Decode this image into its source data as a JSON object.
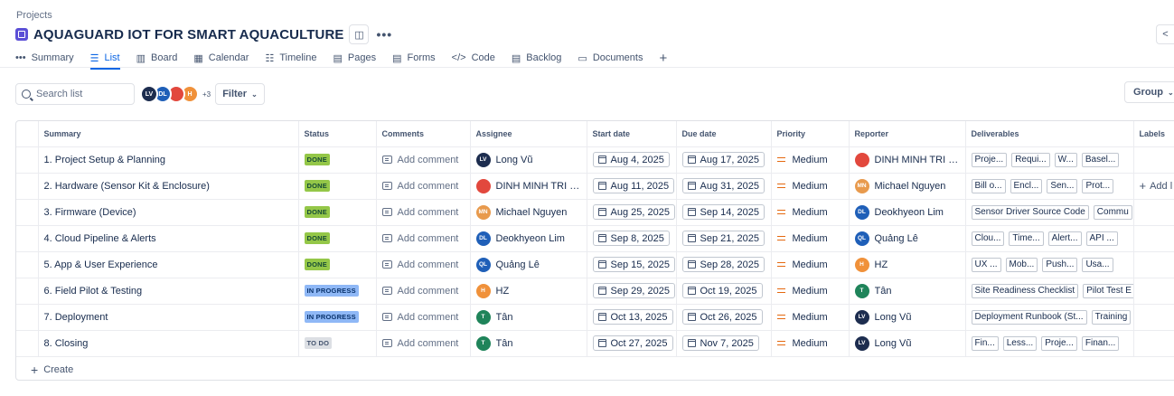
{
  "breadcrumb": "Projects",
  "project": {
    "title": "AQUAGUARD IOT FOR SMART AQUACULTURE",
    "more": "•••"
  },
  "tabs": [
    {
      "label": "Summary",
      "icon": "•••"
    },
    {
      "label": "List",
      "icon": "☰"
    },
    {
      "label": "Board",
      "icon": "▥"
    },
    {
      "label": "Calendar",
      "icon": "▦"
    },
    {
      "label": "Timeline",
      "icon": "☷"
    },
    {
      "label": "Pages",
      "icon": "▤"
    },
    {
      "label": "Forms",
      "icon": "▤"
    },
    {
      "label": "Code",
      "icon": "</>"
    },
    {
      "label": "Backlog",
      "icon": "▤"
    },
    {
      "label": "Documents",
      "icon": "▭"
    }
  ],
  "active_tab": "List",
  "toolbar": {
    "search_placeholder": "Search list",
    "avatars": [
      {
        "initials": "LV",
        "color": "#1d2d4f"
      },
      {
        "initials": "DL",
        "color": "#1f5fb8"
      },
      {
        "initials": "",
        "color": "#e2483d"
      },
      {
        "initials": "H",
        "color": "#f0913a"
      }
    ],
    "more_count": "+3",
    "filter_label": "Filter",
    "group_label": "Group"
  },
  "columns": [
    "Summary",
    "Status",
    "Comments",
    "Assignee",
    "Start date",
    "Due date",
    "Priority",
    "Reporter",
    "Deliverables",
    "Labels"
  ],
  "rows": [
    {
      "summary": "1. Project Setup & Planning",
      "status": "DONE",
      "status_kind": "done",
      "comment": "Add comment",
      "assignee": {
        "initials": "LV",
        "name": "Long Vũ",
        "color": "#1d2d4f"
      },
      "start": "Aug 4, 2025",
      "due": "Aug 17, 2025",
      "priority": "Medium",
      "reporter": {
        "initials": "",
        "name": "DINH MINH TRI VO ...",
        "color": "#e2483d"
      },
      "deliverables": [
        "Proje...",
        "Requi...",
        "W...",
        "Basel..."
      ],
      "labels": ""
    },
    {
      "summary": "2. Hardware (Sensor Kit & Enclosure)",
      "status": "DONE",
      "status_kind": "done",
      "comment": "Add comment",
      "assignee": {
        "initials": "",
        "name": "DINH MINH TRI VO ...",
        "color": "#e2483d"
      },
      "start": "Aug 11, 2025",
      "due": "Aug 31, 2025",
      "priority": "Medium",
      "reporter": {
        "initials": "MN",
        "name": "Michael Nguyen",
        "color": "#e89a4d"
      },
      "deliverables": [
        "Bill o...",
        "Encl...",
        "Sen...",
        "Prot..."
      ],
      "labels": "Add l"
    },
    {
      "summary": "3. Firmware (Device)",
      "status": "DONE",
      "status_kind": "done",
      "comment": "Add comment",
      "assignee": {
        "initials": "MN",
        "name": "Michael Nguyen",
        "color": "#e89a4d"
      },
      "start": "Aug 25, 2025",
      "due": "Sep 14, 2025",
      "priority": "Medium",
      "reporter": {
        "initials": "DL",
        "name": "Deokhyeon Lim",
        "color": "#1f5fb8"
      },
      "deliverables": [
        "Sensor Driver Source Code",
        "Commu"
      ],
      "labels": ""
    },
    {
      "summary": "4. Cloud Pipeline & Alerts",
      "status": "DONE",
      "status_kind": "done",
      "comment": "Add comment",
      "assignee": {
        "initials": "DL",
        "name": "Deokhyeon Lim",
        "color": "#1f5fb8"
      },
      "start": "Sep 8, 2025",
      "due": "Sep 21, 2025",
      "priority": "Medium",
      "reporter": {
        "initials": "QL",
        "name": "Quảng Lê",
        "color": "#1f5fb8"
      },
      "deliverables": [
        "Clou...",
        "Time...",
        "Alert...",
        "API ..."
      ],
      "labels": ""
    },
    {
      "summary": "5. App & User Experience",
      "status": "DONE",
      "status_kind": "done",
      "comment": "Add comment",
      "assignee": {
        "initials": "QL",
        "name": "Quảng Lê",
        "color": "#1f5fb8"
      },
      "start": "Sep 15, 2025",
      "due": "Sep 28, 2025",
      "priority": "Medium",
      "reporter": {
        "initials": "H",
        "name": "HZ",
        "color": "#f0913a"
      },
      "deliverables": [
        "UX ...",
        "Mob...",
        "Push...",
        "Usa..."
      ],
      "labels": ""
    },
    {
      "summary": "6. Field Pilot & Testing",
      "status": "IN PROGRESS",
      "status_kind": "prog",
      "comment": "Add comment",
      "assignee": {
        "initials": "H",
        "name": "HZ",
        "color": "#f0913a"
      },
      "start": "Sep 29, 2025",
      "due": "Oct 19, 2025",
      "priority": "Medium",
      "reporter": {
        "initials": "T",
        "name": "Tân",
        "color": "#1f845a"
      },
      "deliverables": [
        "Site Readiness Checklist",
        "Pilot Test E"
      ],
      "labels": ""
    },
    {
      "summary": "7. Deployment",
      "status": "IN PROGRESS",
      "status_kind": "prog",
      "comment": "Add comment",
      "assignee": {
        "initials": "T",
        "name": "Tân",
        "color": "#1f845a"
      },
      "start": "Oct 13, 2025",
      "due": "Oct 26, 2025",
      "priority": "Medium",
      "reporter": {
        "initials": "LV",
        "name": "Long Vũ",
        "color": "#1d2d4f"
      },
      "deliverables": [
        "Deployment Runbook (St...",
        "Training"
      ],
      "labels": ""
    },
    {
      "summary": "8. Closing",
      "status": "TO DO",
      "status_kind": "todo",
      "comment": "Add comment",
      "assignee": {
        "initials": "T",
        "name": "Tân",
        "color": "#1f845a"
      },
      "start": "Oct 27, 2025",
      "due": "Nov 7, 2025",
      "priority": "Medium",
      "reporter": {
        "initials": "LV",
        "name": "Long Vũ",
        "color": "#1d2d4f"
      },
      "deliverables": [
        "Fin...",
        "Less...",
        "Proje...",
        "Finan..."
      ],
      "labels": ""
    }
  ],
  "create_label": "Create"
}
